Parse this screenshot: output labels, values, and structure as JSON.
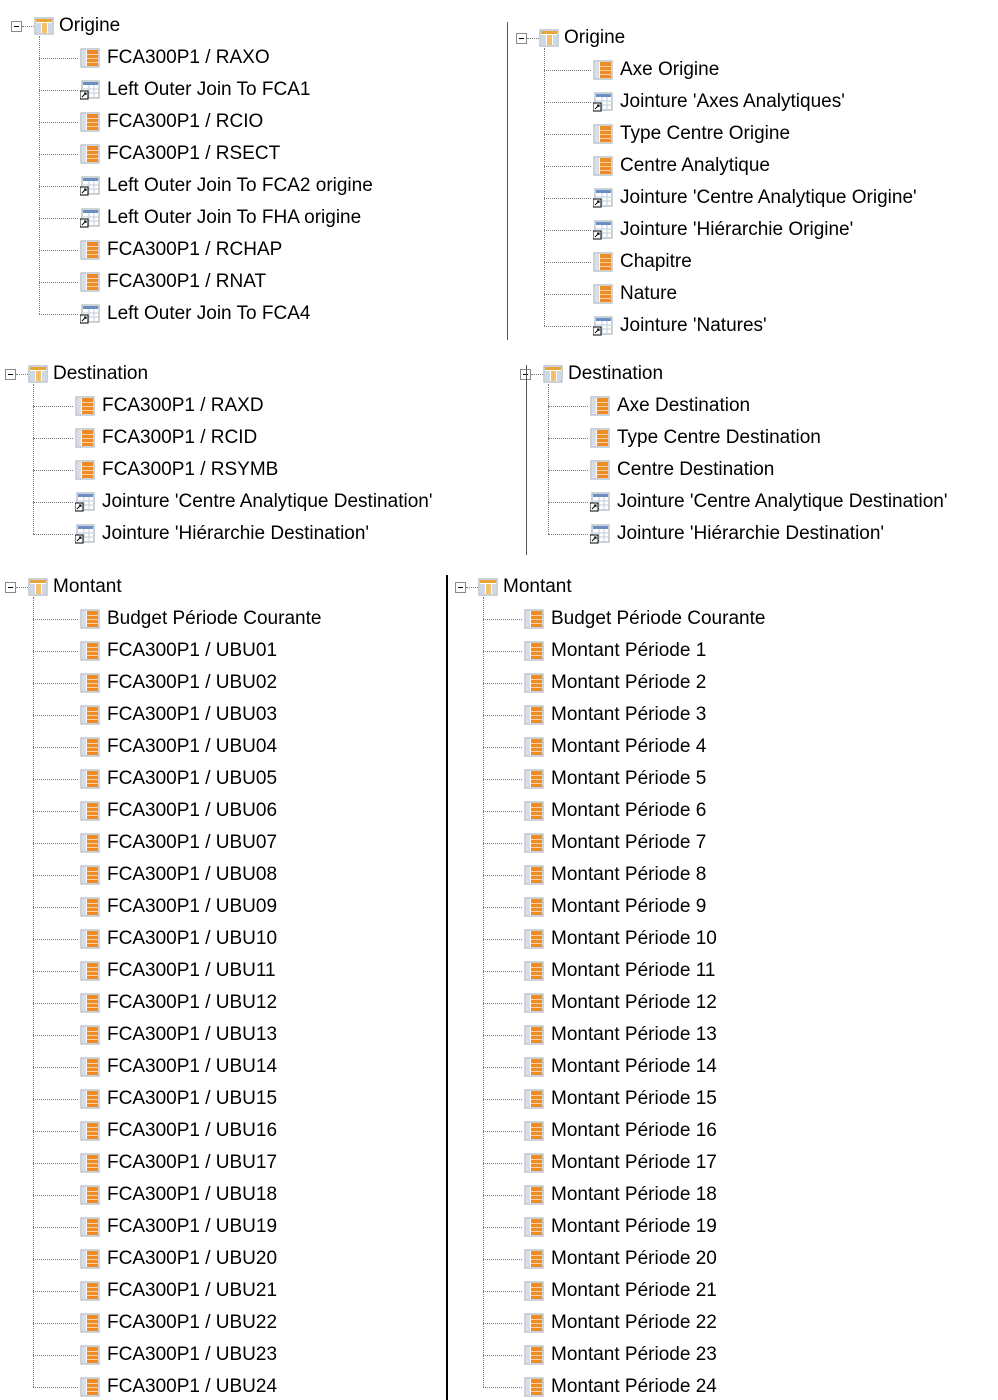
{
  "panels": [
    {
      "id": "origine-src",
      "group": "Origine",
      "items": [
        {
          "label": "FCA300P1 / RAXO",
          "icon": "field-icon"
        },
        {
          "label": "Left Outer Join To FCA1",
          "icon": "join-icon"
        },
        {
          "label": "FCA300P1 / RCIO",
          "icon": "field-icon"
        },
        {
          "label": "FCA300P1 / RSECT",
          "icon": "field-icon"
        },
        {
          "label": "Left Outer Join To FCA2 origine",
          "icon": "join-icon"
        },
        {
          "label": "Left Outer Join To FHA origine",
          "icon": "join-icon"
        },
        {
          "label": "FCA300P1 / RCHAP",
          "icon": "field-icon"
        },
        {
          "label": "FCA300P1 / RNAT",
          "icon": "field-icon"
        },
        {
          "label": "Left Outer Join To FCA4",
          "icon": "join-icon"
        }
      ]
    },
    {
      "id": "origine-dst",
      "group": "Origine",
      "items": [
        {
          "label": "Axe Origine",
          "icon": "field-icon"
        },
        {
          "label": "Jointure 'Axes Analytiques'",
          "icon": "join-icon"
        },
        {
          "label": "Type Centre Origine",
          "icon": "field-icon"
        },
        {
          "label": "Centre Analytique",
          "icon": "field-icon"
        },
        {
          "label": "Jointure 'Centre Analytique Origine'",
          "icon": "join-icon"
        },
        {
          "label": "Jointure 'Hiérarchie Origine'",
          "icon": "join-icon"
        },
        {
          "label": "Chapitre",
          "icon": "field-icon"
        },
        {
          "label": "Nature",
          "icon": "field-icon"
        },
        {
          "label": "Jointure 'Natures'",
          "icon": "join-icon"
        }
      ]
    },
    {
      "id": "destination-src",
      "group": "Destination",
      "items": [
        {
          "label": "FCA300P1 / RAXD",
          "icon": "field-icon"
        },
        {
          "label": "FCA300P1 / RCID",
          "icon": "field-icon"
        },
        {
          "label": "FCA300P1 / RSYMB",
          "icon": "field-icon"
        },
        {
          "label": "Jointure 'Centre Analytique Destination'",
          "icon": "join-icon"
        },
        {
          "label": "Jointure 'Hiérarchie Destination'",
          "icon": "join-icon"
        }
      ]
    },
    {
      "id": "destination-dst",
      "group": "Destination",
      "items": [
        {
          "label": "Axe Destination",
          "icon": "field-icon"
        },
        {
          "label": "Type Centre Destination",
          "icon": "field-icon"
        },
        {
          "label": "Centre Destination",
          "icon": "field-icon"
        },
        {
          "label": "Jointure 'Centre Analytique Destination'",
          "icon": "join-icon"
        },
        {
          "label": "Jointure 'Hiérarchie Destination'",
          "icon": "join-icon"
        }
      ]
    },
    {
      "id": "montant-src",
      "group": "Montant",
      "items": [
        {
          "label": "Budget  Période Courante",
          "icon": "field-icon"
        },
        {
          "label": "FCA300P1 / UBU01",
          "icon": "field-icon"
        },
        {
          "label": "FCA300P1 / UBU02",
          "icon": "field-icon"
        },
        {
          "label": "FCA300P1 / UBU03",
          "icon": "field-icon"
        },
        {
          "label": "FCA300P1 / UBU04",
          "icon": "field-icon"
        },
        {
          "label": "FCA300P1 / UBU05",
          "icon": "field-icon"
        },
        {
          "label": "FCA300P1 / UBU06",
          "icon": "field-icon"
        },
        {
          "label": "FCA300P1 / UBU07",
          "icon": "field-icon"
        },
        {
          "label": "FCA300P1 / UBU08",
          "icon": "field-icon"
        },
        {
          "label": "FCA300P1 / UBU09",
          "icon": "field-icon"
        },
        {
          "label": "FCA300P1 / UBU10",
          "icon": "field-icon"
        },
        {
          "label": "FCA300P1 / UBU11",
          "icon": "field-icon"
        },
        {
          "label": "FCA300P1 / UBU12",
          "icon": "field-icon"
        },
        {
          "label": "FCA300P1 / UBU13",
          "icon": "field-icon"
        },
        {
          "label": "FCA300P1 / UBU14",
          "icon": "field-icon"
        },
        {
          "label": "FCA300P1 / UBU15",
          "icon": "field-icon"
        },
        {
          "label": "FCA300P1 / UBU16",
          "icon": "field-icon"
        },
        {
          "label": "FCA300P1 / UBU17",
          "icon": "field-icon"
        },
        {
          "label": "FCA300P1 / UBU18",
          "icon": "field-icon"
        },
        {
          "label": "FCA300P1 / UBU19",
          "icon": "field-icon"
        },
        {
          "label": "FCA300P1 / UBU20",
          "icon": "field-icon"
        },
        {
          "label": "FCA300P1 / UBU21",
          "icon": "field-icon"
        },
        {
          "label": "FCA300P1 / UBU22",
          "icon": "field-icon"
        },
        {
          "label": "FCA300P1 / UBU23",
          "icon": "field-icon"
        },
        {
          "label": "FCA300P1 / UBU24",
          "icon": "field-icon"
        }
      ]
    },
    {
      "id": "montant-dst",
      "group": "Montant",
      "items": [
        {
          "label": "Budget  Période Courante",
          "icon": "field-icon"
        },
        {
          "label": "Montant Période 1",
          "icon": "field-icon"
        },
        {
          "label": "Montant Période 2",
          "icon": "field-icon"
        },
        {
          "label": "Montant Période 3",
          "icon": "field-icon"
        },
        {
          "label": "Montant Période 4",
          "icon": "field-icon"
        },
        {
          "label": "Montant Période 5",
          "icon": "field-icon"
        },
        {
          "label": "Montant Période 6",
          "icon": "field-icon"
        },
        {
          "label": "Montant Période 7",
          "icon": "field-icon"
        },
        {
          "label": "Montant Période 8",
          "icon": "field-icon"
        },
        {
          "label": "Montant Période 9",
          "icon": "field-icon"
        },
        {
          "label": "Montant Période 10",
          "icon": "field-icon"
        },
        {
          "label": "Montant  Période 11",
          "icon": "field-icon"
        },
        {
          "label": "Montant Période 12",
          "icon": "field-icon"
        },
        {
          "label": "Montant Période 13",
          "icon": "field-icon"
        },
        {
          "label": "Montant Période 14",
          "icon": "field-icon"
        },
        {
          "label": "Montant  Période 15",
          "icon": "field-icon"
        },
        {
          "label": "Montant  Période 16",
          "icon": "field-icon"
        },
        {
          "label": "Montant  Période 17",
          "icon": "field-icon"
        },
        {
          "label": "Montant Période 18",
          "icon": "field-icon"
        },
        {
          "label": "Montant Période 19",
          "icon": "field-icon"
        },
        {
          "label": "Montant Période 20",
          "icon": "field-icon"
        },
        {
          "label": "Montant Période 21",
          "icon": "field-icon"
        },
        {
          "label": "Montant Période 22",
          "icon": "field-icon"
        },
        {
          "label": "Montant Période 23",
          "icon": "field-icon"
        },
        {
          "label": "Montant Période 24",
          "icon": "field-icon"
        }
      ]
    }
  ],
  "colors": {
    "field_icon_orange": "#f08a24",
    "folder_icon": "#e9a53a",
    "join_icon_blue": "#4a7bbf"
  }
}
